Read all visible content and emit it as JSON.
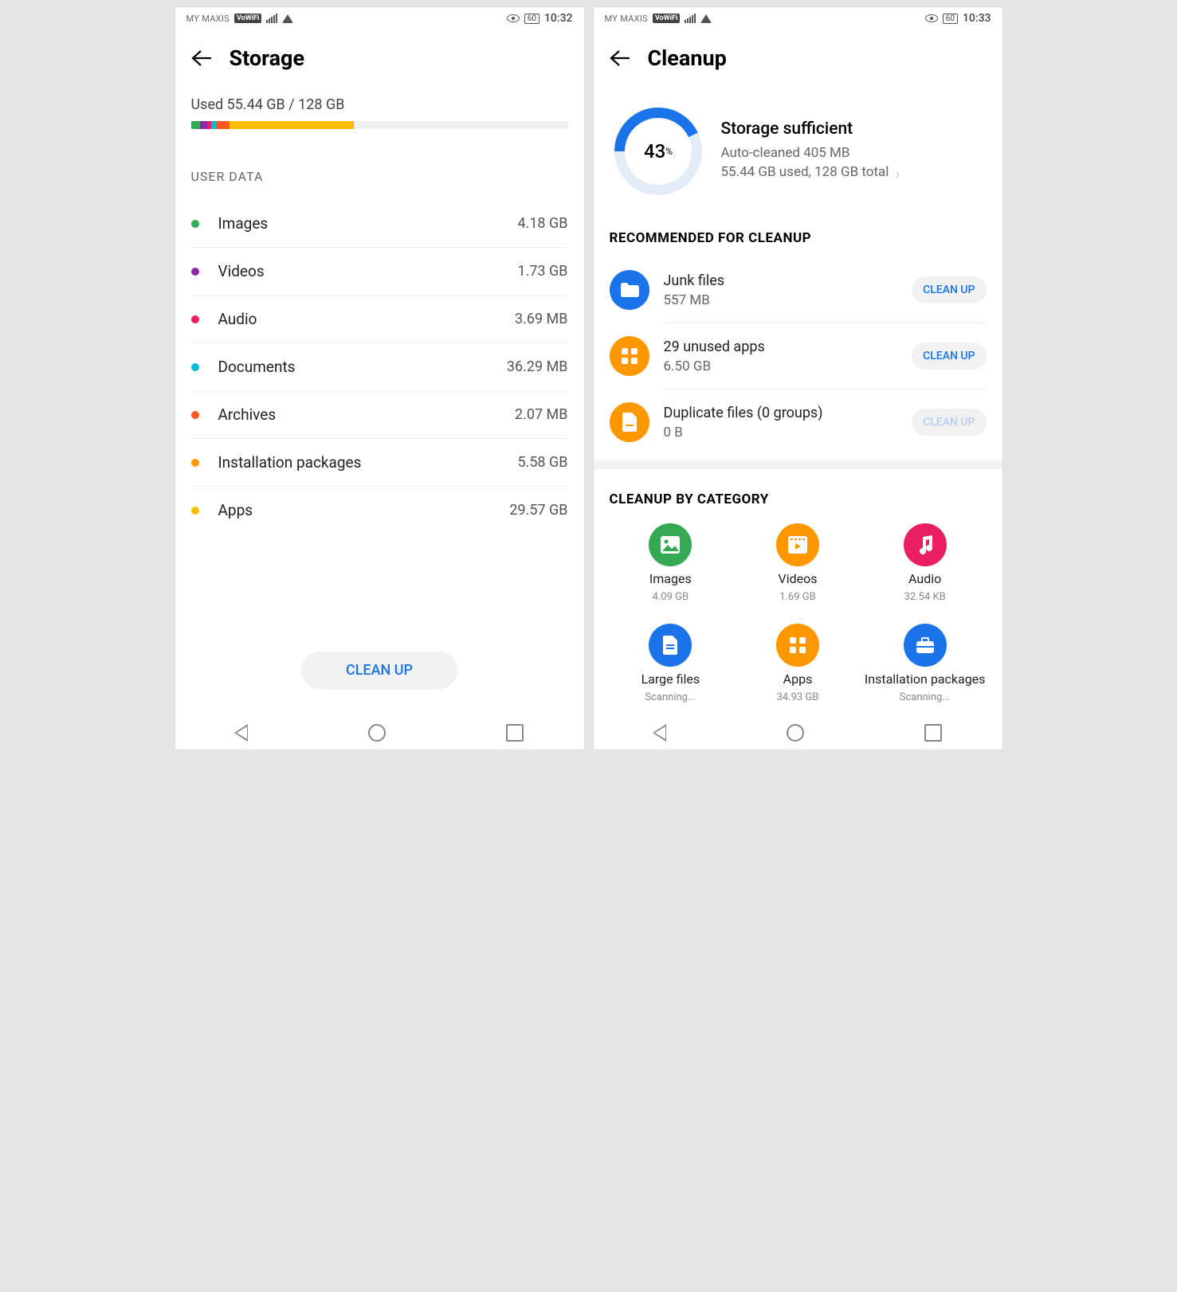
{
  "status": {
    "carrier": "MY MAXIS",
    "vowifi": "VoWiFi",
    "battery": "60",
    "clock_left": "10:32",
    "clock_right": "10:33"
  },
  "storage": {
    "title": "Storage",
    "usage": "Used 55.44 GB / 128 GB",
    "segments": [
      {
        "color": "#34a853",
        "width": 2.5
      },
      {
        "color": "#8e24aa",
        "width": 1.8
      },
      {
        "color": "#e91e63",
        "width": 1.2
      },
      {
        "color": "#00bcd4",
        "width": 1.2
      },
      {
        "color": "#ff5722",
        "width": 3.5
      },
      {
        "color": "#fbbc04",
        "width": 33.1
      }
    ],
    "section": "USER DATA",
    "items": [
      {
        "label": "Images",
        "value": "4.18 GB",
        "color": "#34a853"
      },
      {
        "label": "Videos",
        "value": "1.73 GB",
        "color": "#8e24aa"
      },
      {
        "label": "Audio",
        "value": "3.69 MB",
        "color": "#e91e63"
      },
      {
        "label": "Documents",
        "value": "36.29 MB",
        "color": "#00bcd4"
      },
      {
        "label": "Archives",
        "value": "2.07 MB",
        "color": "#ff5722"
      },
      {
        "label": "Installation packages",
        "value": "5.58 GB",
        "color": "#ff9800"
      },
      {
        "label": "Apps",
        "value": "29.57 GB",
        "color": "#fbbc04"
      }
    ],
    "cleanup_btn": "CLEAN UP"
  },
  "cleanup": {
    "title": "Cleanup",
    "percent": "43",
    "percent_sign": "%",
    "sum_title": "Storage sufficient",
    "sum_line1": "Auto-cleaned 405 MB",
    "sum_line2": "55.44 GB used, 128 GB total",
    "rec_head": "RECOMMENDED FOR CLEANUP",
    "rec": [
      {
        "title": "Junk files",
        "sub": "557 MB",
        "bg": "#1a73e8",
        "icon": "folder",
        "btn": "CLEAN UP",
        "enabled": true
      },
      {
        "title": "29 unused apps",
        "sub": "6.50 GB",
        "bg": "#ff9800",
        "icon": "grid",
        "btn": "CLEAN UP",
        "enabled": true
      },
      {
        "title": "Duplicate files (0 groups)",
        "sub": "0 B",
        "bg": "#ff9800",
        "icon": "file",
        "btn": "CLEAN UP",
        "enabled": false
      }
    ],
    "cat_head": "CLEANUP BY CATEGORY",
    "cats": [
      {
        "title": "Images",
        "sub": "4.09 GB",
        "bg": "#34a853",
        "icon": "image"
      },
      {
        "title": "Videos",
        "sub": "1.69 GB",
        "bg": "#ff9800",
        "icon": "video"
      },
      {
        "title": "Audio",
        "sub": "32.54 KB",
        "bg": "#e91e63",
        "icon": "music"
      },
      {
        "title": "Large files",
        "sub": "Scanning...",
        "bg": "#1a73e8",
        "icon": "doc"
      },
      {
        "title": "Apps",
        "sub": "34.93 GB",
        "bg": "#ff9800",
        "icon": "grid"
      },
      {
        "title": "Installation packages",
        "sub": "Scanning...",
        "bg": "#1a73e8",
        "icon": "bag"
      }
    ]
  }
}
